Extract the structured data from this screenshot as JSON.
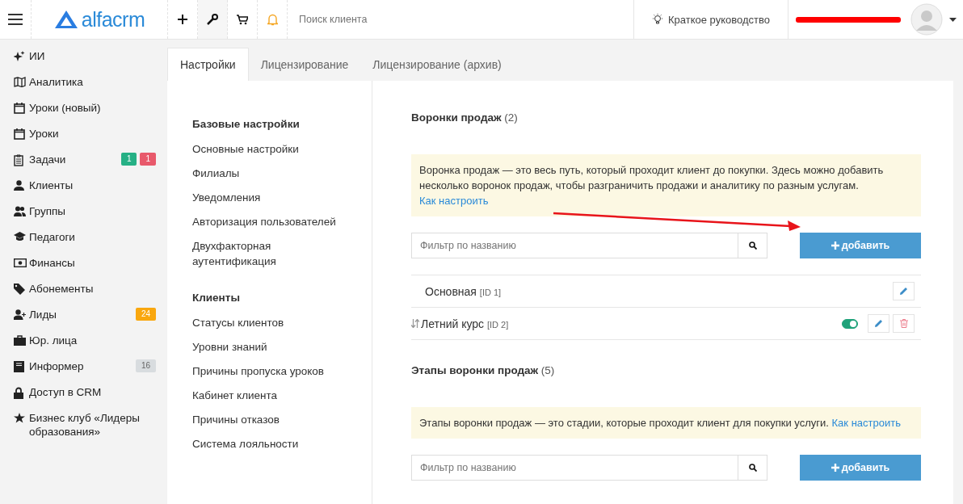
{
  "topbar": {
    "logo": "alfacrm",
    "search": {
      "placeholder": "Поиск клиента"
    },
    "guide": "Краткое руководство"
  },
  "sidebar": {
    "items": [
      {
        "label": "ИИ"
      },
      {
        "label": "Аналитика"
      },
      {
        "label": "Уроки (новый)"
      },
      {
        "label": "Уроки"
      },
      {
        "label": "Задачи",
        "badges": [
          {
            "text": "1",
            "color": "#26b085"
          },
          {
            "text": "1",
            "color": "#e8596b"
          }
        ]
      },
      {
        "label": "Клиенты"
      },
      {
        "label": "Группы"
      },
      {
        "label": "Педагоги"
      },
      {
        "label": "Финансы"
      },
      {
        "label": "Абонементы"
      },
      {
        "label": "Лиды",
        "badges": [
          {
            "text": "24",
            "color": "#f9a70e"
          }
        ]
      },
      {
        "label": "Юр. лица"
      },
      {
        "label": "Информер",
        "badges": [
          {
            "text": "16",
            "color": "#d8dcdf"
          }
        ]
      },
      {
        "label": "Доступ в CRM"
      },
      {
        "label": "Бизнес клуб «Лидеры образования»"
      }
    ]
  },
  "tabs": [
    {
      "label": "Настройки",
      "selected": true
    },
    {
      "label": "Лицензирование",
      "selected": false
    },
    {
      "label": "Лицензирование (архив)",
      "selected": false
    }
  ],
  "settings_menu": [
    {
      "title": "Базовые настройки",
      "items": [
        "Основные настройки",
        "Филиалы",
        "Уведомления",
        "Авторизация пользователей",
        "Двухфакторная аутентификация"
      ]
    },
    {
      "title": "Клиенты",
      "items": [
        "Статусы клиентов",
        "Уровни знаний",
        "Причины пропуска уроков",
        "Кабинет клиента",
        "Причины отказов",
        "Система лояльности"
      ]
    }
  ],
  "sections": [
    {
      "title": "Воронки продаж",
      "count": "(2)",
      "info": "Воронка продаж — это весь путь, который проходит клиент до покупки. Здесь можно добавить несколько воронок продаж, чтобы разграничить продажи и аналитику по разным услугам.",
      "link": "Как настроить",
      "filter_placeholder": "Фильтр по названию",
      "add_button": "добавить",
      "rows": [
        {
          "name": "Основная",
          "id": "[ID 1]",
          "kind": "main"
        },
        {
          "name": "Летний курс",
          "id": "[ID 2]",
          "kind": "custom",
          "on": true
        }
      ]
    },
    {
      "title": "Этапы воронки продаж",
      "count": "(5)",
      "info": "Этапы воронки продаж — это стадии, которые проходит клиент для покупки услуги.",
      "link": "Как настроить",
      "filter_placeholder": "Фильтр по названию",
      "add_button": "добавить"
    }
  ]
}
